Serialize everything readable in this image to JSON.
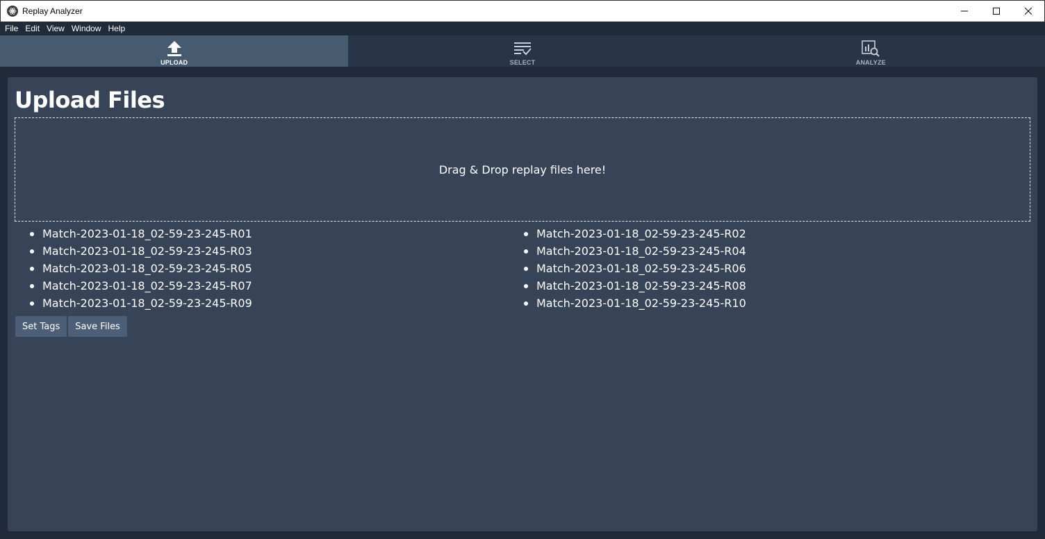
{
  "window": {
    "title": "Replay Analyzer",
    "controls": {
      "minimize": "minimize-icon",
      "maximize": "maximize-icon",
      "close": "close-icon"
    }
  },
  "menu": [
    "File",
    "Edit",
    "View",
    "Window",
    "Help"
  ],
  "tabs": [
    {
      "label": "UPLOAD",
      "icon": "upload-icon",
      "active": true
    },
    {
      "label": "SELECT",
      "icon": "checklist-icon",
      "active": false
    },
    {
      "label": "ANALYZE",
      "icon": "chart-search-icon",
      "active": false
    }
  ],
  "main": {
    "title": "Upload Files",
    "dropzone_text": "Drag & Drop replay files here!",
    "files": [
      "Match-2023-01-18_02-59-23-245-R01",
      "Match-2023-01-18_02-59-23-245-R02",
      "Match-2023-01-18_02-59-23-245-R03",
      "Match-2023-01-18_02-59-23-245-R04",
      "Match-2023-01-18_02-59-23-245-R05",
      "Match-2023-01-18_02-59-23-245-R06",
      "Match-2023-01-18_02-59-23-245-R07",
      "Match-2023-01-18_02-59-23-245-R08",
      "Match-2023-01-18_02-59-23-245-R09",
      "Match-2023-01-18_02-59-23-245-R10"
    ],
    "buttons": {
      "set_tags": "Set Tags",
      "save_files": "Save Files"
    }
  },
  "colors": {
    "background": "#202a3a",
    "panel": "#374458",
    "tab_active": "#465a70",
    "tab_bar": "#283447",
    "button": "#4c5f77"
  }
}
